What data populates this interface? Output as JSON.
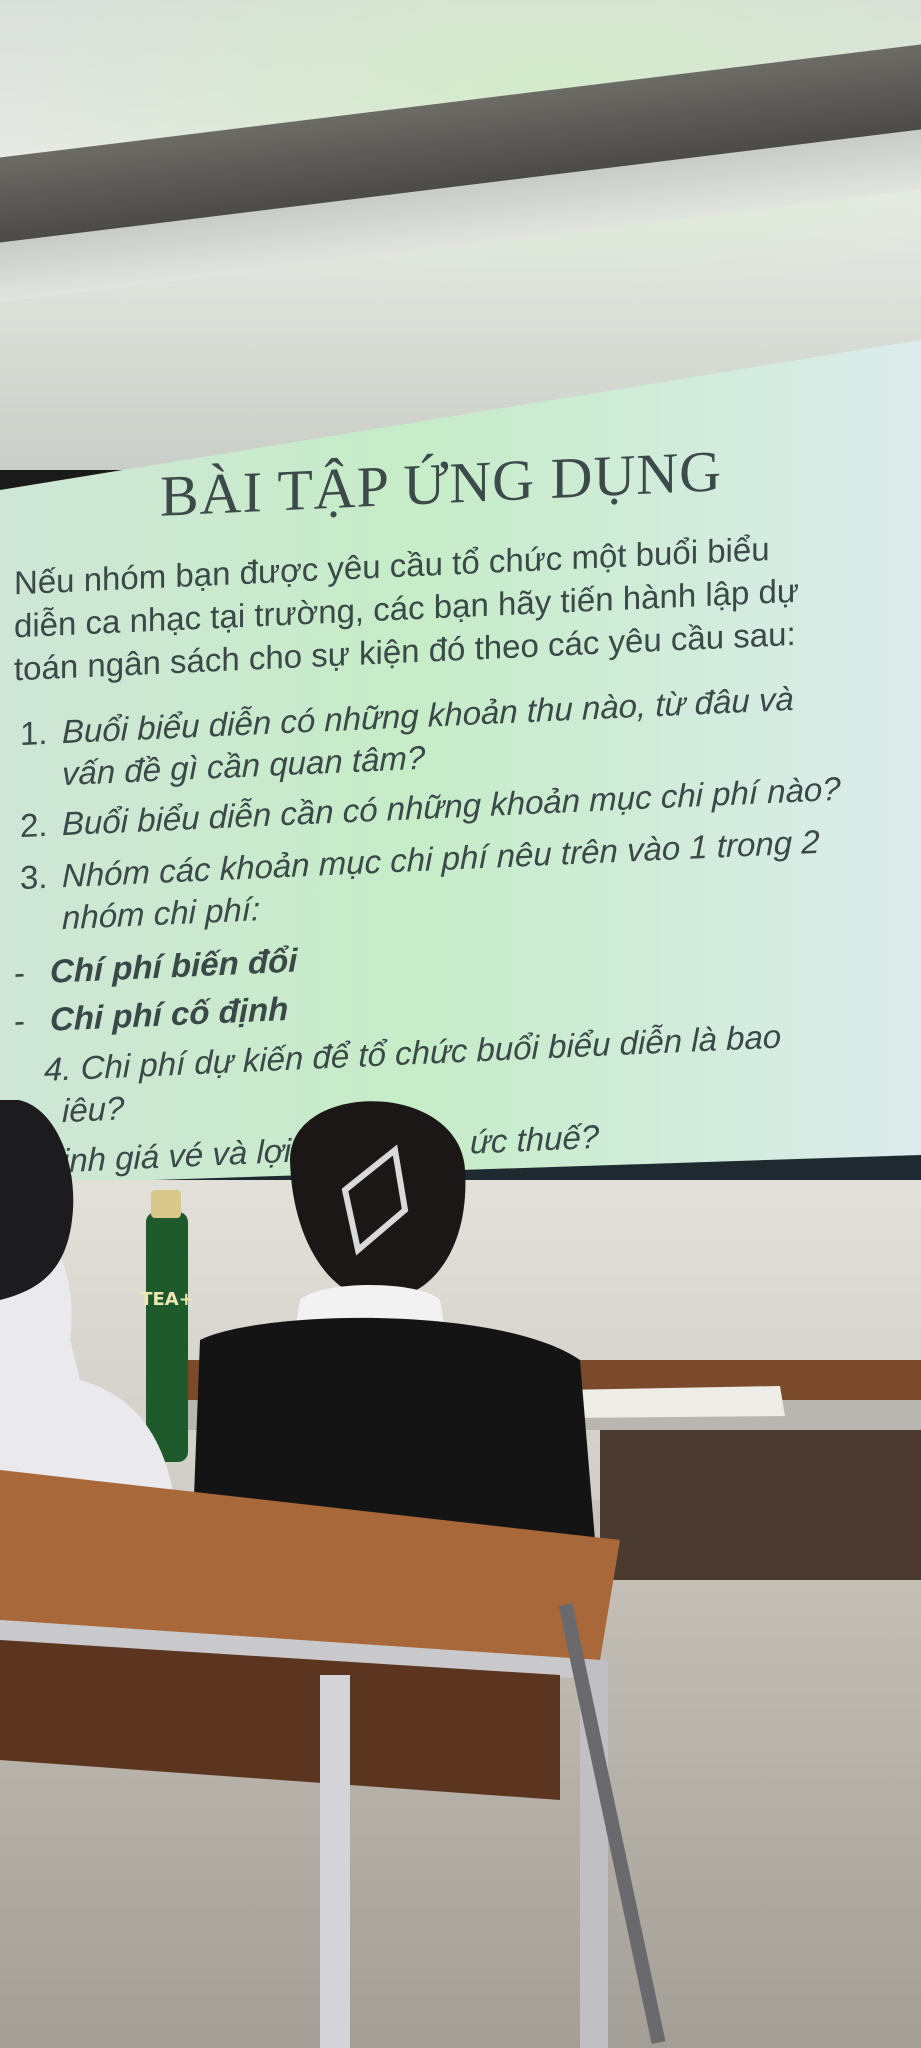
{
  "slide": {
    "title": "BÀI TẬP ỨNG DỤNG",
    "intro": [
      "Nếu nhóm bạn được yêu cầu tổ chức một buổi biểu",
      "diễn ca nhạc tại trường, các bạn hãy tiến hành lập dự",
      "toán ngân sách cho sự kiện đó theo các yêu cầu sau:"
    ],
    "items": [
      {
        "num": "1.",
        "lines": [
          "Buổi biểu diễn có những khoản thu nào, từ đâu và",
          "vấn đề gì cần quan tâm?"
        ]
      },
      {
        "num": "2.",
        "lines": [
          "Buổi biểu diễn cần có những khoản mục chi phí nào?"
        ]
      },
      {
        "num": "3.",
        "lines": [
          "Nhóm các khoản mục chi phí nêu trên vào 1 trong 2",
          "nhóm chi phí:"
        ]
      }
    ],
    "bullets": [
      "Chí phí biến đổi",
      "Chi phí cố định"
    ],
    "item4": [
      "4. Chi phí dự kiến để tổ chức buổi biểu diễn là bao",
      "iêu?"
    ],
    "item5": [
      "ịnh giá vé và lợi",
      "ức thuế?"
    ],
    "bullet_marker": "-"
  },
  "bottle": {
    "label": "TEA+"
  }
}
